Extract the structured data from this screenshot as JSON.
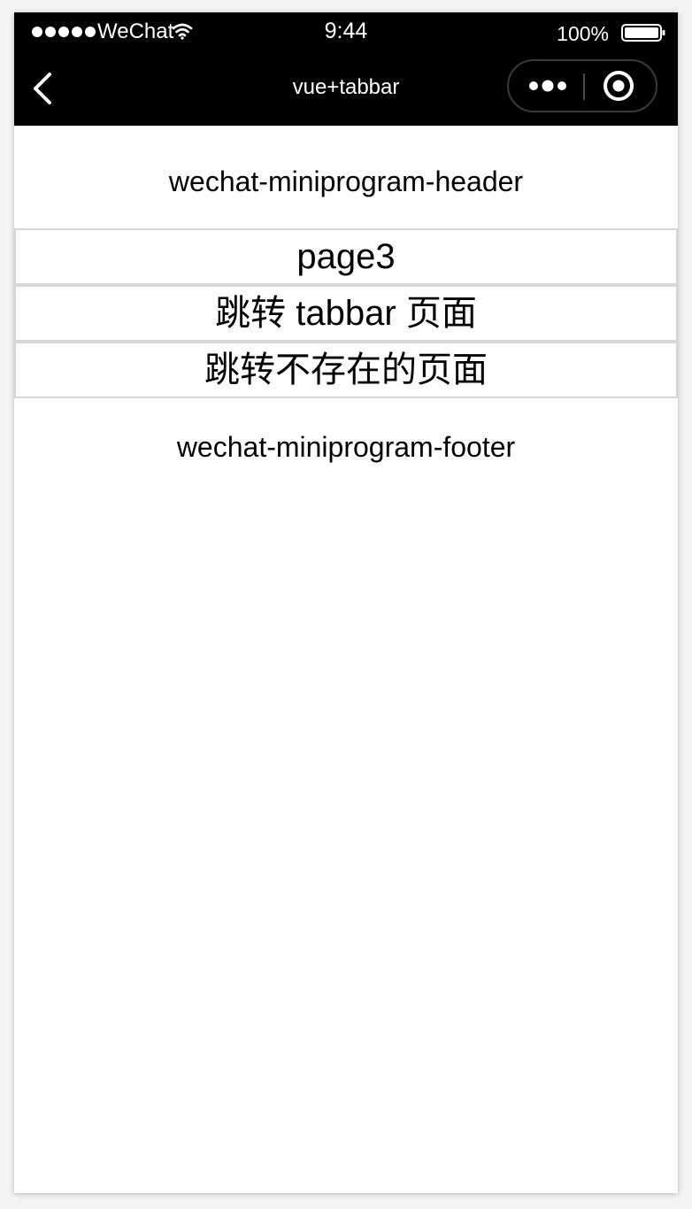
{
  "status_bar": {
    "carrier": "WeChat",
    "time": "9:44",
    "battery": "100%",
    "signal_icon": "signal-dots-icon",
    "wifi_icon": "wifi-icon",
    "battery_icon": "battery-icon"
  },
  "nav_bar": {
    "title": "vue+tabbar",
    "back_icon": "back-chevron-icon",
    "more_icon": "more-dots-icon",
    "close_icon": "target-circle-icon",
    "background": "#000000",
    "foreground": "#ffffff"
  },
  "page": {
    "header": "wechat-miniprogram-header",
    "items": [
      {
        "label": "page3"
      },
      {
        "label": "跳转 tabbar 页面"
      },
      {
        "label": "跳转不存在的页面"
      }
    ],
    "footer": "wechat-miniprogram-footer"
  }
}
